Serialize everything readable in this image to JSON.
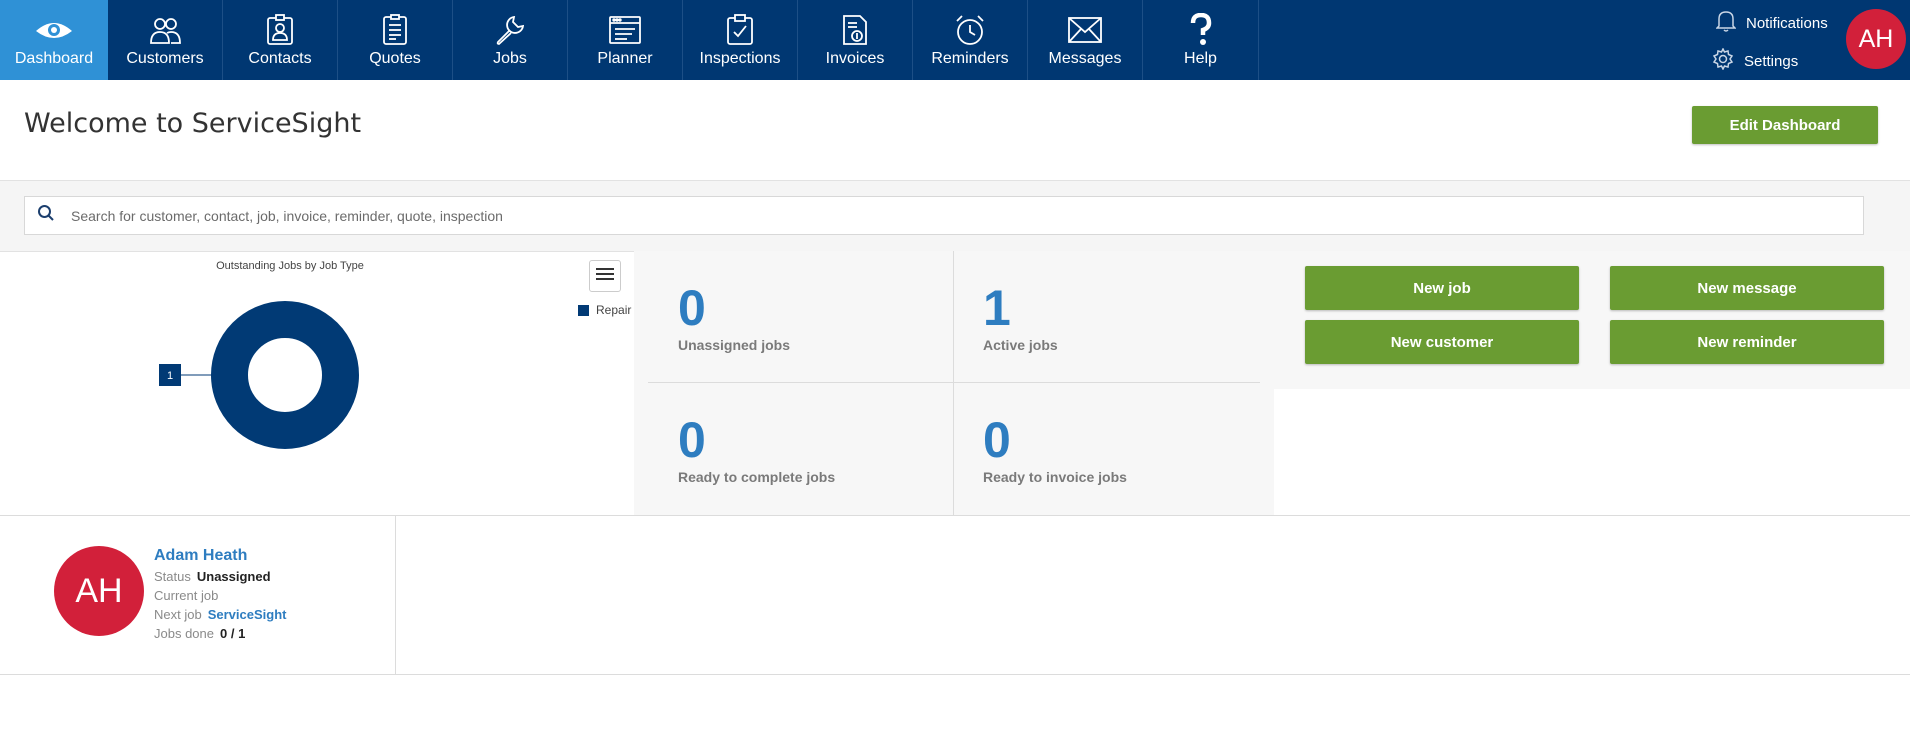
{
  "nav": {
    "items": [
      {
        "label": "Dashboard",
        "icon": "eye-icon",
        "active": true
      },
      {
        "label": "Customers",
        "icon": "people-icon"
      },
      {
        "label": "Contacts",
        "icon": "contact-card-icon"
      },
      {
        "label": "Quotes",
        "icon": "quote-document-icon"
      },
      {
        "label": "Jobs",
        "icon": "wrench-icon"
      },
      {
        "label": "Planner",
        "icon": "planner-icon"
      },
      {
        "label": "Inspections",
        "icon": "clipboard-check-icon"
      },
      {
        "label": "Invoices",
        "icon": "invoice-icon"
      },
      {
        "label": "Reminders",
        "icon": "alarm-clock-icon"
      },
      {
        "label": "Messages",
        "icon": "envelope-icon"
      },
      {
        "label": "Help",
        "icon": "question-mark-icon"
      }
    ],
    "notifications_label": "Notifications",
    "settings_label": "Settings",
    "avatar_initials": "AH"
  },
  "header": {
    "title": "Welcome to ServiceSight",
    "edit_button": "Edit Dashboard"
  },
  "search": {
    "placeholder": "Search for customer, contact, job, invoice, reminder, quote, inspection",
    "value": ""
  },
  "chart_data": {
    "type": "pie",
    "title": "Outstanding Jobs by Job Type",
    "categories": [
      "Repair"
    ],
    "values": [
      1
    ],
    "data_labels": [
      "1"
    ],
    "colors": [
      "#013a75"
    ],
    "legend_position": "top-right"
  },
  "stats": [
    {
      "value": "0",
      "label": "Unassigned jobs"
    },
    {
      "value": "1",
      "label": "Active jobs"
    },
    {
      "value": "0",
      "label": "Ready to complete jobs"
    },
    {
      "value": "0",
      "label": "Ready to invoice jobs"
    }
  ],
  "actions": {
    "new_job": "New job",
    "new_message": "New message",
    "new_customer": "New customer",
    "new_reminder": "New reminder"
  },
  "staff": {
    "initials": "AH",
    "name": "Adam Heath",
    "status_label": "Status",
    "status_value": "Unassigned",
    "current_job_label": "Current job",
    "next_job_label": "Next job",
    "next_job_value": "ServiceSight",
    "jobs_done_label": "Jobs done",
    "jobs_done_value": "0 / 1"
  },
  "colors": {
    "nav_bg": "#003772",
    "nav_active": "#2f91d6",
    "accent_green": "#6a9c32",
    "stat_blue": "#2e7dc0",
    "avatar_red": "#d2203a"
  }
}
